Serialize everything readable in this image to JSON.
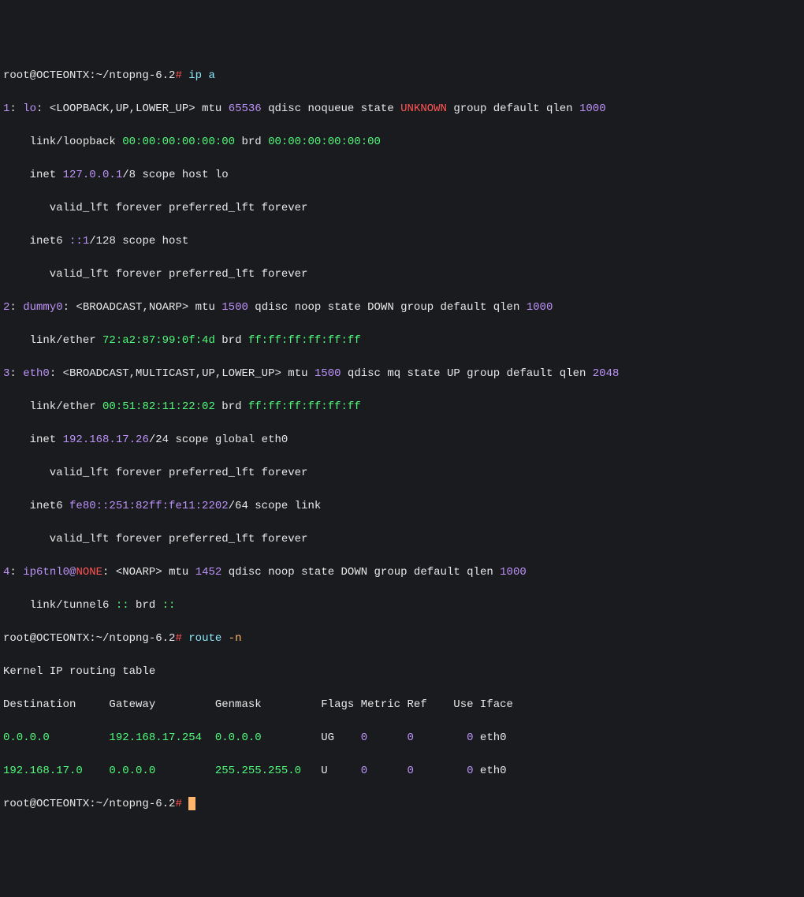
{
  "prompt1": {
    "user": "root@OCTEONTX",
    "colon": ":",
    "path": "~/ntopng-6.2",
    "hash": "#",
    "cmd": " ip a"
  },
  "if1": {
    "idx": "1",
    "colon1": ":",
    "name": " lo",
    "colon2": ":",
    "flags": " <LOOPBACK,UP,LOWER_UP>",
    "mtu_lbl": " mtu ",
    "mtu_val": "65536",
    "qdisc": " qdisc noqueue state ",
    "state": "UNKNOWN",
    "tail": " group default qlen ",
    "qlen": "1000",
    "link_pre": "    link/loopback ",
    "mac1": "00:00:00:00:00:00",
    "brd_lbl": " brd ",
    "mac2": "00:00:00:00:00:00",
    "inet_pre": "    inet ",
    "inet_ip": "127.0.0.1",
    "inet_mask": "/8",
    "inet_scope": " scope host lo",
    "valid1": "       valid_lft forever preferred_lft forever",
    "inet6_pre": "    inet6 ",
    "inet6_ip": "::1",
    "inet6_mask": "/128",
    "inet6_scope": " scope host",
    "valid2": "       valid_lft forever preferred_lft forever"
  },
  "if2": {
    "idx": "2",
    "colon1": ":",
    "name": " dummy0",
    "colon2": ":",
    "flags": " <BROADCAST,NOARP>",
    "mtu_lbl": " mtu ",
    "mtu_val": "1500",
    "qdisc": " qdisc noop state DOWN group default qlen ",
    "qlen": "1000",
    "link_pre": "    link/ether ",
    "mac1": "72:a2:87:99:0f:4d",
    "brd_lbl": " brd ",
    "mac2": "ff:ff:ff:ff:ff:ff"
  },
  "if3": {
    "idx": "3",
    "colon1": ":",
    "name": " eth0",
    "colon2": ":",
    "flags": " <BROADCAST,MULTICAST,UP,LOWER_UP>",
    "mtu_lbl": " mtu ",
    "mtu_val": "1500",
    "qdisc": " qdisc mq state UP group default qlen ",
    "qlen": "2048",
    "link_pre": "    link/ether ",
    "mac1": "00:51:82:11:22:02",
    "brd_lbl": " brd ",
    "mac2": "ff:ff:ff:ff:ff:ff",
    "inet_pre": "    inet ",
    "inet_ip": "192.168.17.26",
    "inet_mask": "/24",
    "inet_scope": " scope global eth0",
    "valid1": "       valid_lft forever preferred_lft forever",
    "inet6_pre": "    inet6 ",
    "inet6_ip": "fe80::251:82ff:fe11:2202",
    "inet6_mask": "/64",
    "inet6_scope": " scope link",
    "valid2": "       valid_lft forever preferred_lft forever"
  },
  "if4": {
    "idx": "4",
    "colon1": ":",
    "name": " ip6tnl0@",
    "none": "NONE",
    "colon2": ":",
    "flags": " <NOARP>",
    "mtu_lbl": " mtu ",
    "mtu_val": "1452",
    "qdisc": " qdisc noop state DOWN group default qlen ",
    "qlen": "1000",
    "link_pre": "    link/tunnel6 ",
    "mac1": "::",
    "brd_lbl": " brd ",
    "mac2": "::"
  },
  "prompt2": {
    "user": "root@OCTEONTX",
    "colon": ":",
    "path": "~/ntopng-6.2",
    "hash": "#",
    "cmd": " route ",
    "opt": "-n"
  },
  "route": {
    "title": "Kernel IP routing table",
    "hdr": "Destination     Gateway         Genmask         Flags Metric Ref    Use Iface",
    "r1a": "0.0.0.0         192.168.17.254  0.0.0.0",
    "r1b": "         UG    ",
    "r1c": "0      0        0",
    "r1d": " eth0",
    "r2a": "192.168.17.0    0.0.0.0         255.255.255.0",
    "r2b": "   U     ",
    "r2c": "0      0        0",
    "r2d": " eth0"
  },
  "prompt3": {
    "user": "root@OCTEONTX",
    "colon": ":",
    "path": "~/ntopng-6.2",
    "hash": "#",
    "sp": " "
  }
}
